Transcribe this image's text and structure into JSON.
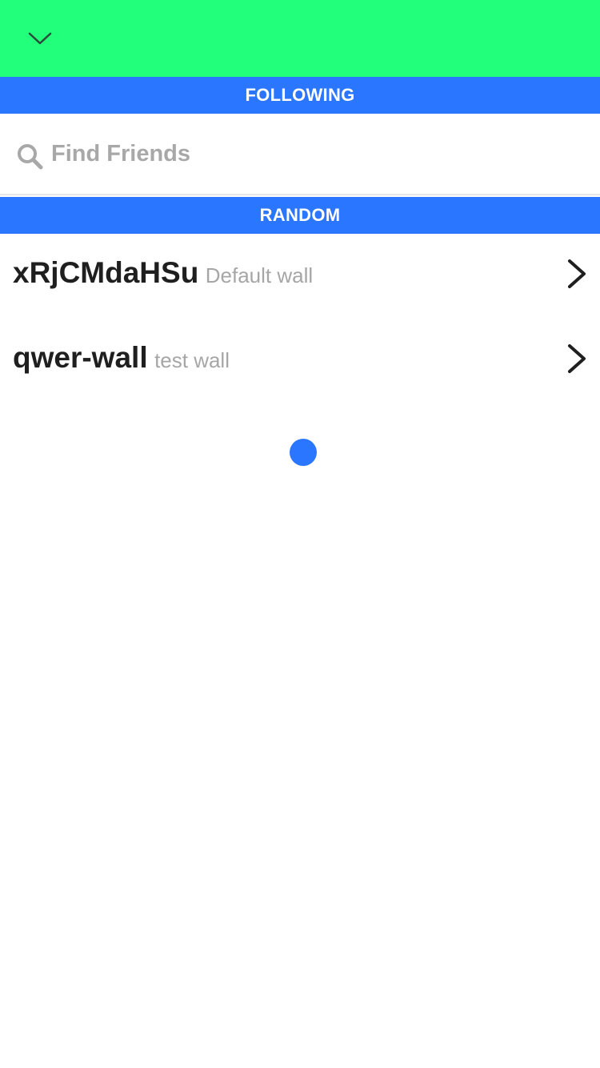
{
  "topbar": {
    "background": "#22ff7a",
    "collapse_icon": "chevron-down-icon"
  },
  "sections": {
    "following_label": "FOLLOWING",
    "random_label": "RANDOM",
    "header_color": "#2b76ff"
  },
  "search": {
    "icon": "search-icon",
    "placeholder": "Find Friends",
    "value": ""
  },
  "walls": [
    {
      "name": "xRjCMdaHSu",
      "description": "Default wall",
      "icon": "chevron-right-icon"
    },
    {
      "name": "qwer-wall",
      "description": "test wall",
      "icon": "chevron-right-icon"
    }
  ],
  "loading": {
    "indicator": "loading-dot",
    "color": "#2b76ff"
  }
}
